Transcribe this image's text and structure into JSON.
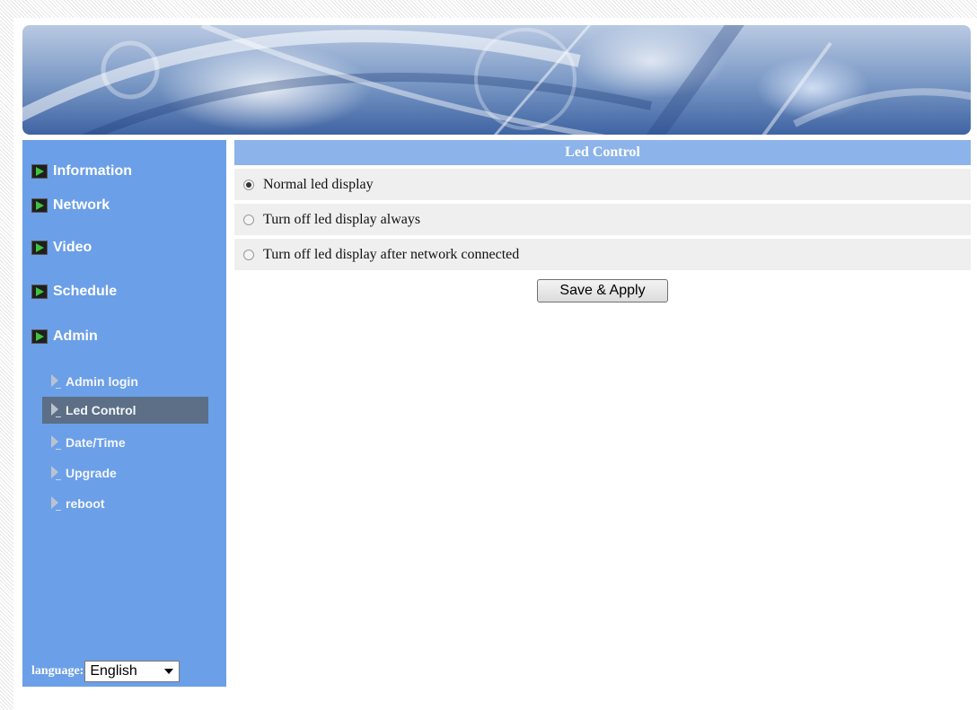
{
  "sidebar": {
    "nav": [
      {
        "label": "Information"
      },
      {
        "label": "Network"
      },
      {
        "label": "Video"
      },
      {
        "label": "Schedule"
      },
      {
        "label": "Admin"
      }
    ],
    "sub": [
      {
        "label": "Admin login",
        "active": false
      },
      {
        "label": "Led Control",
        "active": true
      },
      {
        "label": "Date/Time",
        "active": false
      },
      {
        "label": "Upgrade",
        "active": false
      },
      {
        "label": "reboot",
        "active": false
      }
    ],
    "language_label": "language:",
    "language_value": "English"
  },
  "main": {
    "title": "Led Control",
    "options": [
      {
        "label": "Normal led display",
        "checked": true
      },
      {
        "label": "Turn off led display always",
        "checked": false
      },
      {
        "label": "Turn off led display after network connected",
        "checked": false
      }
    ],
    "save_label": "Save & Apply"
  },
  "colors": {
    "sidebar_bg": "#6b9fe8",
    "header_bg": "#8cb3ea",
    "active_sub_bg": "#5c6f86",
    "nav_arrow_green": "#3ec43e"
  }
}
